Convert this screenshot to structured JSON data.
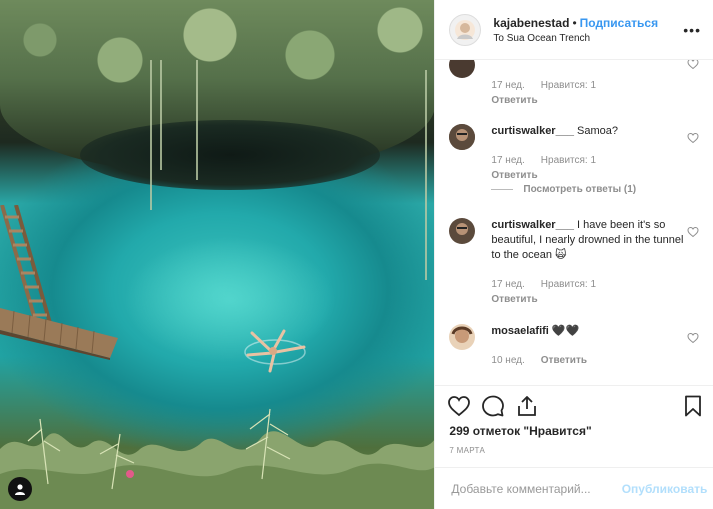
{
  "post": {
    "username": "kajabenestad",
    "follow_label": "Подписаться",
    "location": "To Sua Ocean Trench",
    "more_label": "•••"
  },
  "comments": [
    {
      "username": "",
      "text": "",
      "time": "17 нед.",
      "likes": "Нравится: 1",
      "reply": "Ответить"
    },
    {
      "username": "curtiswalker___",
      "text": "Samoa?",
      "time": "17 нед.",
      "likes": "Нравится: 1",
      "reply": "Ответить",
      "view_replies": "Посмотреть ответы (1)"
    },
    {
      "username": "curtiswalker___",
      "text": "I have been it's so beautiful, I nearly drowned in the tunnel to the ocean 🙀",
      "time": "17 нед.",
      "likes": "Нравится: 1",
      "reply": "Ответить"
    },
    {
      "username": "mosaelafifi",
      "text": "🖤🖤",
      "time": "10 нед.",
      "likes": "",
      "reply": "Ответить"
    }
  ],
  "likes_text": "299 отметок \"Нравится\"",
  "date": "7 МАРТА",
  "comment_input": {
    "placeholder": "Добавьте комментарий...",
    "value": ""
  },
  "publish_label": "Опубликовать",
  "icons": {
    "like": "heart-icon",
    "comment": "comment-icon",
    "share": "share-icon",
    "save": "bookmark-icon",
    "user_badge": "user-icon",
    "more": "more-icon"
  },
  "colors": {
    "accent": "#3897f0",
    "publish_disabled": "#b2dffc",
    "meta": "#8e8e8e",
    "water": "#22a9ab"
  }
}
